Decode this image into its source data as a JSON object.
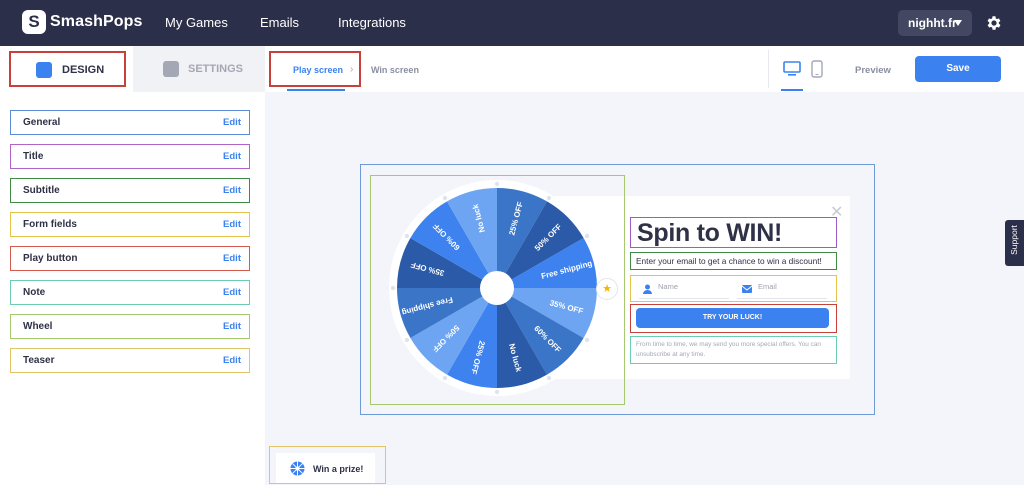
{
  "brand": {
    "name": "SmashPops",
    "mark": "S"
  },
  "nav": {
    "items": [
      "My Games",
      "Emails",
      "Integrations"
    ]
  },
  "site_selector": {
    "value": "nighht.fr"
  },
  "left_tabs": {
    "design": "DESIGN",
    "settings": "SETTINGS"
  },
  "sections": [
    {
      "label": "General",
      "edit": "Edit",
      "color": "#5b8bd6"
    },
    {
      "label": "Title",
      "edit": "Edit",
      "color": "#b163c9"
    },
    {
      "label": "Subtitle",
      "edit": "Edit",
      "color": "#3f8a45"
    },
    {
      "label": "Form fields",
      "edit": "Edit",
      "color": "#e6c44b"
    },
    {
      "label": "Play button",
      "edit": "Edit",
      "color": "#d45a4e"
    },
    {
      "label": "Note",
      "edit": "Edit",
      "color": "#6ccbb3"
    },
    {
      "label": "Wheel",
      "edit": "Edit",
      "color": "#a6c86e"
    },
    {
      "label": "Teaser",
      "edit": "Edit",
      "color": "#e2c46a"
    }
  ],
  "screens": {
    "play": "Play screen",
    "win": "Win screen"
  },
  "toolbar": {
    "preview": "Preview",
    "save": "Save"
  },
  "wheel": {
    "segments": [
      "25% OFF",
      "50% OFF",
      "Free shipping",
      "35% OFF",
      "60% OFF",
      "No luck",
      "25% OFF",
      "50% OFF",
      "Free shipping",
      "35% OFF",
      "60% OFF",
      "No luck"
    ],
    "colors": [
      "#3b75c8",
      "#2a5aa8",
      "#3d82ef",
      "#6ea5f2",
      "#3b75c8",
      "#2a5aa8",
      "#3d82ef",
      "#6ea5f2",
      "#3b75c8",
      "#2a5aa8",
      "#3d82ef",
      "#6ea5f2"
    ]
  },
  "popup": {
    "title": "Spin to WIN!",
    "subtitle": "Enter your email to get a chance to win a discount!",
    "name_placeholder": "Name",
    "email_placeholder": "Email",
    "button": "TRY YOUR LUCK!",
    "note": "From time to time, we may send you more special offers. You can unsubscribe at any time."
  },
  "teaser": {
    "label": "Win a prize!"
  },
  "support": {
    "label": "Support"
  },
  "colors": {
    "accent": "#3b82f0",
    "nav_bg": "#2c2f4a",
    "highlight": "#c8403a"
  }
}
